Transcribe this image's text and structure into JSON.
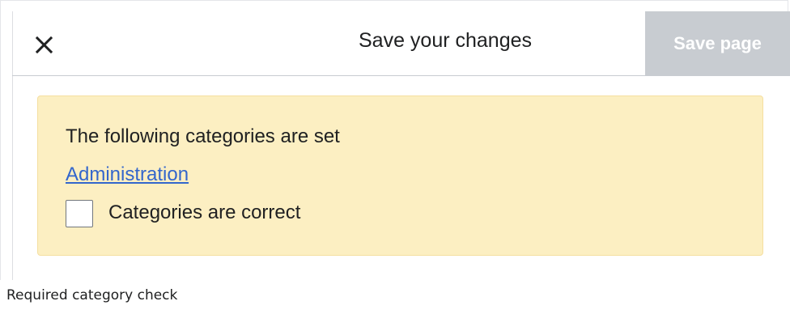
{
  "dialog": {
    "title": "Save your changes",
    "close_icon": "close-icon",
    "save_button_label": "Save page",
    "save_button_state": "disabled"
  },
  "notice": {
    "message": "The following categories are set",
    "category_link": "Administration",
    "checkbox_label": "Categories are correct",
    "checkbox_checked": false
  },
  "caption": "Required category check",
  "colors": {
    "notice_background": "#fcefc2",
    "link": "#3366cc",
    "save_button_disabled": "#c8ccd1"
  }
}
